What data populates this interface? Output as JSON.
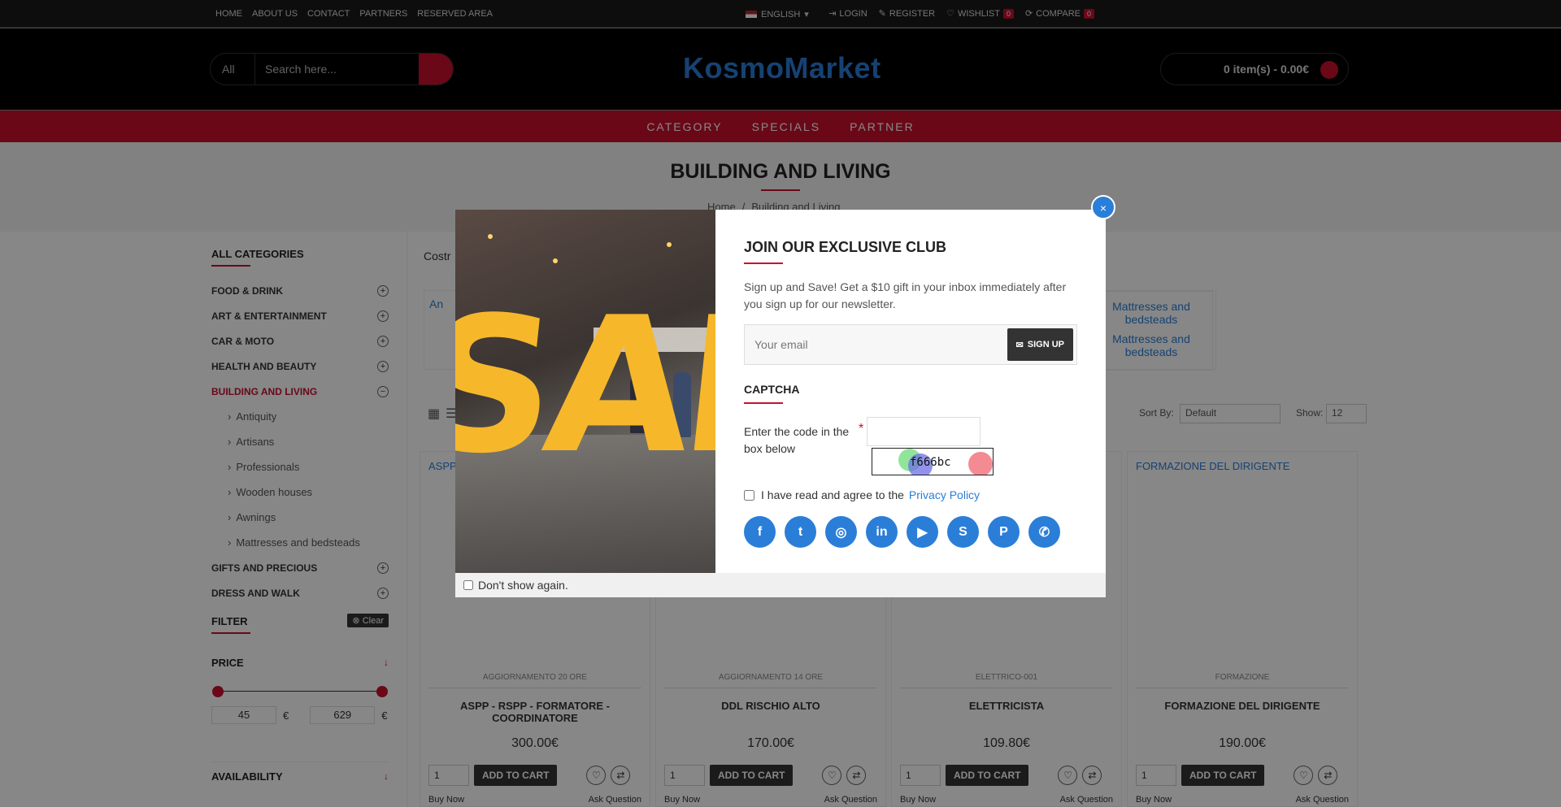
{
  "topbar": {
    "links": [
      "HOME",
      "ABOUT US",
      "CONTACT",
      "PARTNERS",
      "RESERVED AREA"
    ],
    "language": "ENGLISH",
    "login": "LOGIN",
    "register": "REGISTER",
    "wishlist": "WISHLIST",
    "wishlist_count": "0",
    "compare": "COMPARE",
    "compare_count": "0"
  },
  "header": {
    "search_category": "All",
    "search_placeholder": "Search here...",
    "logo": "KosmoMarket",
    "cart": "0 item(s) - 0.00€"
  },
  "nav": [
    "CATEGORY",
    "SPECIALS",
    "PARTNER"
  ],
  "page": {
    "title": "BUILDING AND LIVING",
    "breadcrumb": [
      "Home",
      "Building and Living"
    ]
  },
  "sidebar": {
    "heading": "ALL CATEGORIES",
    "categories": [
      "FOOD & DRINK",
      "ART & ENTERTAINMENT",
      "CAR & MOTO",
      "HEALTH AND BEAUTY",
      "BUILDING AND LIVING",
      "GIFTS AND PRECIOUS",
      "DRESS AND WALK"
    ],
    "subcategories": [
      "Antiquity",
      "Artisans",
      "Professionals",
      "Wooden houses",
      "Awnings",
      "Mattresses and bedsteads"
    ],
    "filter_heading": "FILTER",
    "clear_label": "Clear",
    "price_heading": "PRICE",
    "price_min": "45",
    "price_max": "629",
    "currency": "€",
    "availability_heading": "AVAILABILITY"
  },
  "content": {
    "intro": "Costr",
    "subcat_left": "An",
    "subcat_right": "Mattresses and bedsteads",
    "sort_label": "Sort By:",
    "sort_value": "Default",
    "show_label": "Show:",
    "show_value": "12"
  },
  "products": [
    {
      "link": "ASPP - RSPP - COORD",
      "code": "AGGIORNAMENTO 20 ORE",
      "name": "ASPP - RSPP - FORMATORE - COORDINATORE",
      "price": "300.00€"
    },
    {
      "link": "",
      "code": "AGGIORNAMENTO 14 ORE",
      "name": "DDL RISCHIO ALTO",
      "price": "170.00€"
    },
    {
      "link": "",
      "code": "ELETTRICO-001",
      "name": "ELETTRICISTA",
      "price": "109.80€"
    },
    {
      "link": "FORMAZIONE DEL DIRIGENTE",
      "code": "FORMAZIONE",
      "name": "FORMAZIONE DEL DIRIGENTE",
      "price": "190.00€"
    }
  ],
  "product_common": {
    "qty": "1",
    "add_to_cart": "ADD TO CART",
    "buy_now": "Buy Now",
    "ask_question": "Ask Question"
  },
  "modal": {
    "title": "JOIN OUR EXCLUSIVE CLUB",
    "description": "Sign up and Save! Get a $10 gift in your inbox immediately after you sign up for our newsletter.",
    "email_placeholder": "Your email",
    "signup_label": "SIGN UP",
    "captcha_heading": "CAPTCHA",
    "captcha_label": "Enter the code in the box below",
    "required_mark": "*",
    "captcha_code": "f666bc",
    "agree_text": "I have read and agree to the",
    "privacy_link": "Privacy Policy",
    "dont_show": "Don't show again.",
    "close_symbol": "×",
    "image_text": "SALE",
    "social_icons": [
      "facebook-icon",
      "twitter-icon",
      "instagram-icon",
      "linkedin-icon",
      "youtube-icon",
      "skype-icon",
      "pinterest-icon",
      "whatsapp-icon"
    ]
  },
  "colors": {
    "accent": "#c8102e",
    "brand_blue": "#2a7ed8",
    "dark": "#333333"
  }
}
